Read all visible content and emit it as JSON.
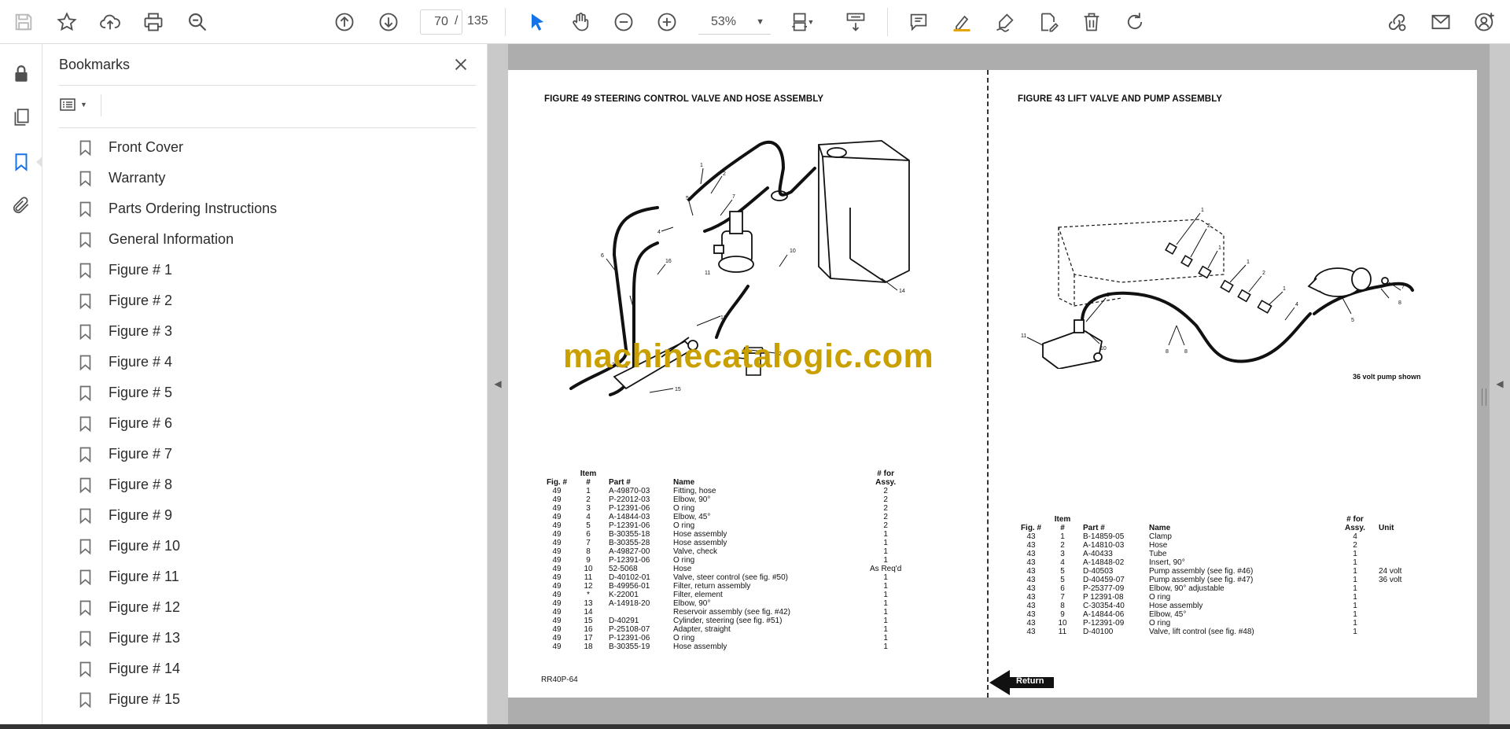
{
  "toolbar": {
    "current_page": "70",
    "page_separator": "/",
    "total_pages": "135",
    "zoom": "53%"
  },
  "bookmarks": {
    "title": "Bookmarks",
    "items": [
      {
        "label": "Front Cover"
      },
      {
        "label": "Warranty"
      },
      {
        "label": "Parts Ordering Instructions"
      },
      {
        "label": "General Information"
      },
      {
        "label": "Figure # 1"
      },
      {
        "label": "Figure # 2"
      },
      {
        "label": "Figure # 3"
      },
      {
        "label": "Figure # 4"
      },
      {
        "label": "Figure # 5"
      },
      {
        "label": "Figure # 6"
      },
      {
        "label": "Figure # 7"
      },
      {
        "label": "Figure # 8"
      },
      {
        "label": "Figure # 9"
      },
      {
        "label": "Figure # 10"
      },
      {
        "label": "Figure # 11"
      },
      {
        "label": "Figure # 12"
      },
      {
        "label": "Figure # 13"
      },
      {
        "label": "Figure # 14"
      },
      {
        "label": "Figure # 15"
      }
    ]
  },
  "document": {
    "watermark": "machinecatalogic.com",
    "left": {
      "title": "FIGURE 49 STEERING CONTROL VALVE AND HOSE ASSEMBLY",
      "footer": "RR40P-64",
      "headers": {
        "fig": "Fig. #",
        "item": "Item #",
        "part": "Part #",
        "name": "Name",
        "qty": "# for Assy."
      },
      "rows": [
        {
          "fig": "49",
          "item": "1",
          "part": "A-49870-03",
          "name": "Fitting, hose",
          "qty": "2"
        },
        {
          "fig": "49",
          "item": "2",
          "part": "P-22012-03",
          "name": "Elbow, 90°",
          "qty": "2"
        },
        {
          "fig": "49",
          "item": "3",
          "part": "P-12391-06",
          "name": "O ring",
          "qty": "2"
        },
        {
          "fig": "49",
          "item": "4",
          "part": "A-14844-03",
          "name": "Elbow, 45°",
          "qty": "2"
        },
        {
          "fig": "49",
          "item": "5",
          "part": "P-12391-06",
          "name": "O ring",
          "qty": "2"
        },
        {
          "fig": "49",
          "item": "6",
          "part": "B-30355-18",
          "name": "Hose assembly",
          "qty": "1"
        },
        {
          "fig": "49",
          "item": "7",
          "part": "B-30355-28",
          "name": "Hose assembly",
          "qty": "1"
        },
        {
          "fig": "49",
          "item": "8",
          "part": "A-49827-00",
          "name": "Valve, check",
          "qty": "1"
        },
        {
          "fig": "49",
          "item": "9",
          "part": "P-12391-06",
          "name": "O ring",
          "qty": "1"
        },
        {
          "fig": "49",
          "item": "10",
          "part": "52-5068",
          "name": "Hose",
          "qty": "As Req'd"
        },
        {
          "fig": "49",
          "item": "11",
          "part": "D-40102-01",
          "name": "Valve, steer control (see fig. #50)",
          "qty": "1"
        },
        {
          "fig": "49",
          "item": "12",
          "part": "B-49956-01",
          "name": "Filter, return assembly",
          "qty": "1"
        },
        {
          "fig": "49",
          "item": "*",
          "part": "K-22001",
          "name": "Filter, element",
          "qty": "1"
        },
        {
          "fig": "49",
          "item": "13",
          "part": "A-14918-20",
          "name": "Elbow, 90°",
          "qty": "1"
        },
        {
          "fig": "49",
          "item": "14",
          "part": "",
          "name": "Reservoir assembly (see fig. #42)",
          "qty": "1"
        },
        {
          "fig": "49",
          "item": "15",
          "part": "D-40291",
          "name": "Cylinder, steering (see fig. #51)",
          "qty": "1"
        },
        {
          "fig": "49",
          "item": "16",
          "part": "P-25108-07",
          "name": "Adapter, straight",
          "qty": "1"
        },
        {
          "fig": "49",
          "item": "17",
          "part": "P-12391-06",
          "name": "O ring",
          "qty": "1"
        },
        {
          "fig": "49",
          "item": "18",
          "part": "B-30355-19",
          "name": "Hose assembly",
          "qty": "1"
        }
      ]
    },
    "right": {
      "title": "FIGURE 43 LIFT VALVE AND PUMP ASSEMBLY",
      "pump_note": "36 volt pump shown",
      "return_label": "Return",
      "headers": {
        "fig": "Fig. #",
        "item": "Item #",
        "part": "Part #",
        "name": "Name",
        "qty": "# for Assy.",
        "unit": "Unit"
      },
      "rows": [
        {
          "fig": "43",
          "item": "1",
          "part": "B-14859-05",
          "name": "Clamp",
          "qty": "4",
          "unit": ""
        },
        {
          "fig": "43",
          "item": "2",
          "part": "A-14810-03",
          "name": "Hose",
          "qty": "2",
          "unit": ""
        },
        {
          "fig": "43",
          "item": "3",
          "part": "A-40433",
          "name": "Tube",
          "qty": "1",
          "unit": ""
        },
        {
          "fig": "43",
          "item": "4",
          "part": "A-14848-02",
          "name": "Insert, 90°",
          "qty": "1",
          "unit": ""
        },
        {
          "fig": "43",
          "item": "5",
          "part": "D-40503",
          "name": "Pump assembly (see fig. #46)",
          "qty": "1",
          "unit": "24 volt"
        },
        {
          "fig": "43",
          "item": "5",
          "part": "D-40459-07",
          "name": "Pump assembly (see fig. #47)",
          "qty": "1",
          "unit": "36 volt"
        },
        {
          "fig": "43",
          "item": "6",
          "part": "P-25377-09",
          "name": "Elbow, 90° adjustable",
          "qty": "1",
          "unit": ""
        },
        {
          "fig": "43",
          "item": "7",
          "part": "P 12391-08",
          "name": "O ring",
          "qty": "1",
          "unit": ""
        },
        {
          "fig": "43",
          "item": "8",
          "part": "C-30354-40",
          "name": "Hose assembly",
          "qty": "1",
          "unit": ""
        },
        {
          "fig": "43",
          "item": "9",
          "part": "A-14844-06",
          "name": "Elbow, 45°",
          "qty": "1",
          "unit": ""
        },
        {
          "fig": "43",
          "item": "10",
          "part": "P-12391-09",
          "name": "O ring",
          "qty": "1",
          "unit": ""
        },
        {
          "fig": "43",
          "item": "11",
          "part": "D-40100",
          "name": "Valve, lift control (see fig. #48)",
          "qty": "1",
          "unit": ""
        }
      ]
    }
  }
}
